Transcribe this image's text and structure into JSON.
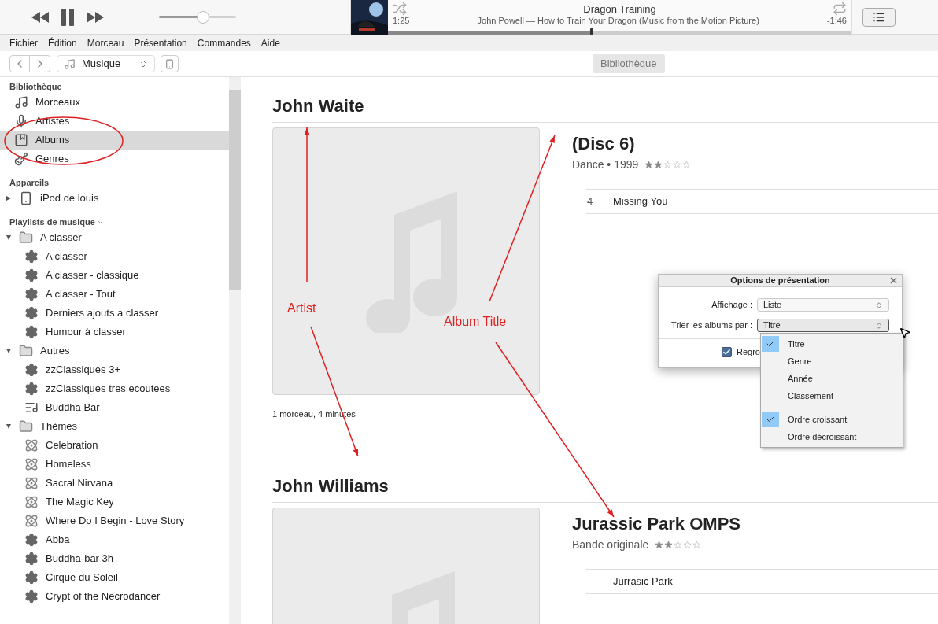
{
  "player": {
    "volume": {
      "level": 0.57
    },
    "now_playing": {
      "title": "Dragon Training",
      "subtitle": "John Powell — How to Train Your Dragon (Music from the Motion Picture)",
      "elapsed": "1:25",
      "remaining": "-1:46",
      "progress": {
        "level": 0.44
      }
    }
  },
  "menu": [
    "Fichier",
    "Édition",
    "Morceau",
    "Présentation",
    "Commandes",
    "Aide"
  ],
  "toolbar": {
    "media_select": "Musique",
    "center_tab": "Bibliothèque"
  },
  "library": {
    "title": "Bibliothèque",
    "items": [
      {
        "label": "Morceaux",
        "kind": "note",
        "selected": false
      },
      {
        "label": "Artistes",
        "kind": "mic",
        "selected": false
      },
      {
        "label": "Albums",
        "kind": "album",
        "selected": true
      },
      {
        "label": "Genres",
        "kind": "genre",
        "selected": false
      }
    ]
  },
  "devices": {
    "title": "Appareils",
    "items": [
      {
        "label": "iPod de louis",
        "kind": "device",
        "expanded": false
      }
    ]
  },
  "playlists": {
    "title": "Playlists de musique",
    "items": [
      {
        "label": "A classer",
        "kind": "folder",
        "expanded": true,
        "children": [
          {
            "label": "A classer",
            "kind": "smart"
          },
          {
            "label": "A classer - classique",
            "kind": "smart"
          },
          {
            "label": "A classer - Tout",
            "kind": "smart"
          },
          {
            "label": "Derniers ajouts a classer",
            "kind": "smart"
          },
          {
            "label": "Humour à classer",
            "kind": "smart"
          }
        ]
      },
      {
        "label": "Autres",
        "kind": "folder",
        "expanded": true,
        "children": [
          {
            "label": "zzClassiques 3+",
            "kind": "smart"
          },
          {
            "label": "zzClassiques tres ecoutees",
            "kind": "smart"
          },
          {
            "label": "Buddha Bar",
            "kind": "list"
          }
        ]
      },
      {
        "label": "Thèmes",
        "kind": "folder",
        "expanded": true,
        "children": [
          {
            "label": "Celebration",
            "kind": "genius"
          },
          {
            "label": "Homeless",
            "kind": "genius"
          },
          {
            "label": "Sacral Nirvana",
            "kind": "genius"
          },
          {
            "label": "The Magic Key",
            "kind": "genius"
          },
          {
            "label": "Where Do I Begin - Love Story",
            "kind": "genius"
          },
          {
            "label": "Abba",
            "kind": "smart"
          },
          {
            "label": "Buddha-bar 3h",
            "kind": "smart"
          },
          {
            "label": "Cirque du Soleil",
            "kind": "smart"
          },
          {
            "label": "Crypt of the Necrodancer",
            "kind": "smart"
          }
        ]
      }
    ]
  },
  "albums": [
    {
      "artist": "John Waite",
      "title": "(Disc 6)",
      "meta": "Dance • 1999",
      "stars": 2,
      "tracks": [
        {
          "number": "4",
          "name": "Missing You"
        }
      ],
      "summary": "1 morceau, 4 minutes"
    },
    {
      "artist": "John Williams",
      "title": "Jurassic Park OMPS",
      "meta": "Bande originale",
      "stars": 2,
      "tracks": [
        {
          "name": "Jurrasic Park"
        }
      ]
    }
  ],
  "dialog": {
    "title": "Options de présentation",
    "fields": [
      {
        "label": "Affichage :",
        "value": "Liste",
        "focused": false
      },
      {
        "label": "Trier les albums par :",
        "value": "Titre",
        "focused": true
      }
    ],
    "checkbox": {
      "label": "Regro",
      "checked": true
    }
  },
  "sort_menu": {
    "groups": [
      [
        {
          "label": "Titre",
          "checked": true
        },
        {
          "label": "Genre",
          "checked": false
        },
        {
          "label": "Année",
          "checked": false
        },
        {
          "label": "Classement",
          "checked": false
        }
      ],
      [
        {
          "label": "Ordre croissant",
          "checked": true
        },
        {
          "label": "Ordre décroissant",
          "checked": false
        }
      ]
    ]
  },
  "annotations": {
    "labels": [
      "Artist",
      "Album Title"
    ]
  }
}
